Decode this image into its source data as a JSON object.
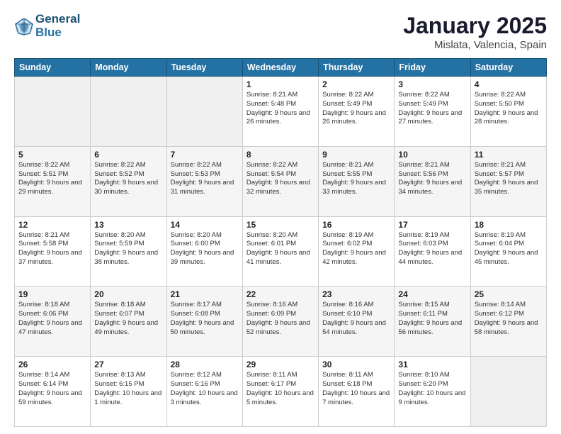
{
  "logo": {
    "line1": "General",
    "line2": "Blue"
  },
  "title": "January 2025",
  "location": "Mislata, Valencia, Spain",
  "days_header": [
    "Sunday",
    "Monday",
    "Tuesday",
    "Wednesday",
    "Thursday",
    "Friday",
    "Saturday"
  ],
  "weeks": [
    [
      {
        "num": "",
        "text": ""
      },
      {
        "num": "",
        "text": ""
      },
      {
        "num": "",
        "text": ""
      },
      {
        "num": "1",
        "text": "Sunrise: 8:21 AM\nSunset: 5:48 PM\nDaylight: 9 hours and 26 minutes."
      },
      {
        "num": "2",
        "text": "Sunrise: 8:22 AM\nSunset: 5:49 PM\nDaylight: 9 hours and 26 minutes."
      },
      {
        "num": "3",
        "text": "Sunrise: 8:22 AM\nSunset: 5:49 PM\nDaylight: 9 hours and 27 minutes."
      },
      {
        "num": "4",
        "text": "Sunrise: 8:22 AM\nSunset: 5:50 PM\nDaylight: 9 hours and 28 minutes."
      }
    ],
    [
      {
        "num": "5",
        "text": "Sunrise: 8:22 AM\nSunset: 5:51 PM\nDaylight: 9 hours and 29 minutes."
      },
      {
        "num": "6",
        "text": "Sunrise: 8:22 AM\nSunset: 5:52 PM\nDaylight: 9 hours and 30 minutes."
      },
      {
        "num": "7",
        "text": "Sunrise: 8:22 AM\nSunset: 5:53 PM\nDaylight: 9 hours and 31 minutes."
      },
      {
        "num": "8",
        "text": "Sunrise: 8:22 AM\nSunset: 5:54 PM\nDaylight: 9 hours and 32 minutes."
      },
      {
        "num": "9",
        "text": "Sunrise: 8:21 AM\nSunset: 5:55 PM\nDaylight: 9 hours and 33 minutes."
      },
      {
        "num": "10",
        "text": "Sunrise: 8:21 AM\nSunset: 5:56 PM\nDaylight: 9 hours and 34 minutes."
      },
      {
        "num": "11",
        "text": "Sunrise: 8:21 AM\nSunset: 5:57 PM\nDaylight: 9 hours and 35 minutes."
      }
    ],
    [
      {
        "num": "12",
        "text": "Sunrise: 8:21 AM\nSunset: 5:58 PM\nDaylight: 9 hours and 37 minutes."
      },
      {
        "num": "13",
        "text": "Sunrise: 8:20 AM\nSunset: 5:59 PM\nDaylight: 9 hours and 38 minutes."
      },
      {
        "num": "14",
        "text": "Sunrise: 8:20 AM\nSunset: 6:00 PM\nDaylight: 9 hours and 39 minutes."
      },
      {
        "num": "15",
        "text": "Sunrise: 8:20 AM\nSunset: 6:01 PM\nDaylight: 9 hours and 41 minutes."
      },
      {
        "num": "16",
        "text": "Sunrise: 8:19 AM\nSunset: 6:02 PM\nDaylight: 9 hours and 42 minutes."
      },
      {
        "num": "17",
        "text": "Sunrise: 8:19 AM\nSunset: 6:03 PM\nDaylight: 9 hours and 44 minutes."
      },
      {
        "num": "18",
        "text": "Sunrise: 8:19 AM\nSunset: 6:04 PM\nDaylight: 9 hours and 45 minutes."
      }
    ],
    [
      {
        "num": "19",
        "text": "Sunrise: 8:18 AM\nSunset: 6:06 PM\nDaylight: 9 hours and 47 minutes."
      },
      {
        "num": "20",
        "text": "Sunrise: 8:18 AM\nSunset: 6:07 PM\nDaylight: 9 hours and 49 minutes."
      },
      {
        "num": "21",
        "text": "Sunrise: 8:17 AM\nSunset: 6:08 PM\nDaylight: 9 hours and 50 minutes."
      },
      {
        "num": "22",
        "text": "Sunrise: 8:16 AM\nSunset: 6:09 PM\nDaylight: 9 hours and 52 minutes."
      },
      {
        "num": "23",
        "text": "Sunrise: 8:16 AM\nSunset: 6:10 PM\nDaylight: 9 hours and 54 minutes."
      },
      {
        "num": "24",
        "text": "Sunrise: 8:15 AM\nSunset: 6:11 PM\nDaylight: 9 hours and 56 minutes."
      },
      {
        "num": "25",
        "text": "Sunrise: 8:14 AM\nSunset: 6:12 PM\nDaylight: 9 hours and 58 minutes."
      }
    ],
    [
      {
        "num": "26",
        "text": "Sunrise: 8:14 AM\nSunset: 6:14 PM\nDaylight: 9 hours and 59 minutes."
      },
      {
        "num": "27",
        "text": "Sunrise: 8:13 AM\nSunset: 6:15 PM\nDaylight: 10 hours and 1 minute."
      },
      {
        "num": "28",
        "text": "Sunrise: 8:12 AM\nSunset: 6:16 PM\nDaylight: 10 hours and 3 minutes."
      },
      {
        "num": "29",
        "text": "Sunrise: 8:11 AM\nSunset: 6:17 PM\nDaylight: 10 hours and 5 minutes."
      },
      {
        "num": "30",
        "text": "Sunrise: 8:11 AM\nSunset: 6:18 PM\nDaylight: 10 hours and 7 minutes."
      },
      {
        "num": "31",
        "text": "Sunrise: 8:10 AM\nSunset: 6:20 PM\nDaylight: 10 hours and 9 minutes."
      },
      {
        "num": "",
        "text": ""
      }
    ]
  ]
}
